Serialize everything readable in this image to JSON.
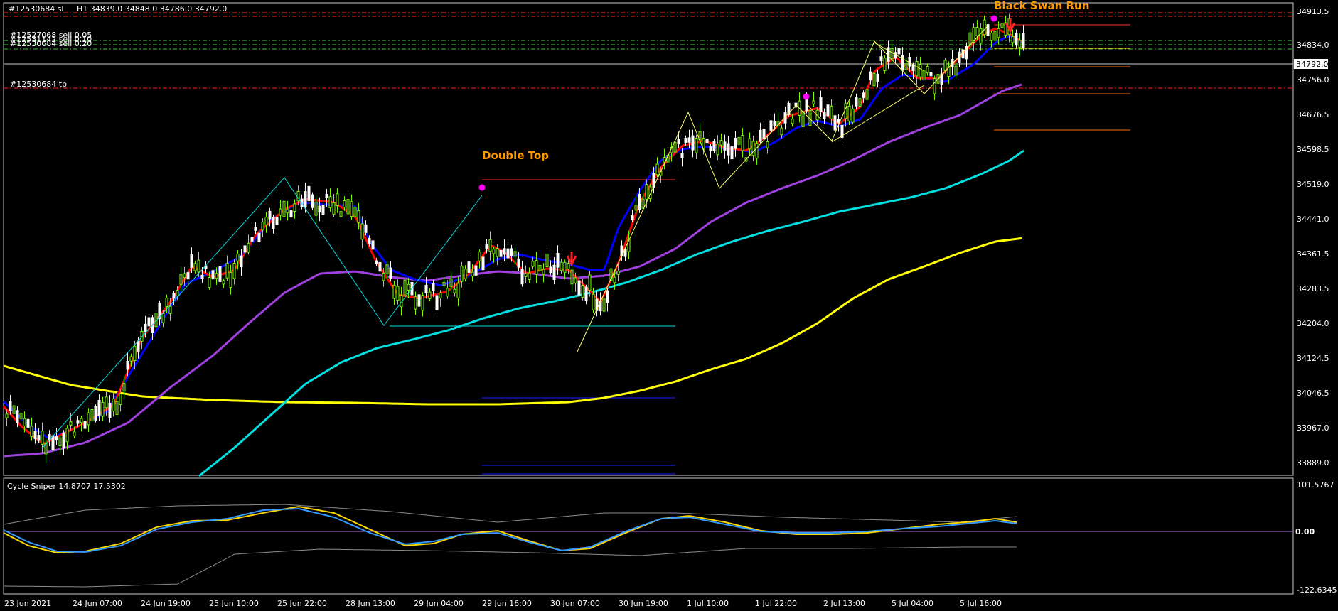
{
  "colors": {
    "background": "#000000",
    "frame": "#c8c8c8",
    "bull_candle": "#7cfc00",
    "bear_candle": "#ffffff",
    "ma_fast": "#ff0000",
    "ma_mid": "#0000ff",
    "ma_slow": "#a040e0",
    "ma_slower": "#00e0e0",
    "ma_slowest": "#ffff00",
    "order_line": "#ff2020",
    "order_line_green": "#30d030",
    "pattern_label": "#ff9900",
    "signal_dot": "#ff00ff",
    "osc_yellow": "#ffd700",
    "osc_blue": "#3399ff",
    "osc_zero": "#b070e0",
    "osc_band": "#8c8c8c"
  },
  "header": {
    "symbol_text": "#12530684 sl",
    "ohlc_text": "H1  34839.0 34848.0 34786.0 34792.0"
  },
  "orders": [
    {
      "label": "#12527068 sell 0.05"
    },
    {
      "label": "#12531142 sell 0.10"
    },
    {
      "label": "#12530684 sell 0.20"
    },
    {
      "label": "#12530684 tp"
    }
  ],
  "patterns": {
    "double_top": "Double Top",
    "black_swan": "Black Swan Run"
  },
  "price_axis": {
    "ticks": [
      "34913.5",
      "34834.0",
      "34756.0",
      "34676.5",
      "34598.5",
      "34519.0",
      "34441.0",
      "34361.5",
      "34283.5",
      "34204.0",
      "34124.5",
      "34046.5",
      "33967.0",
      "33889.0"
    ],
    "current_price": "34792.0"
  },
  "time_axis": {
    "labels": [
      "23 Jun 2021",
      "24 Jun 07:00",
      "24 Jun 19:00",
      "25 Jun 10:00",
      "25 Jun 22:00",
      "28 Jun 13:00",
      "29 Jun 04:00",
      "29 Jun 16:00",
      "30 Jun 07:00",
      "30 Jun 19:00",
      "1 Jul 10:00",
      "1 Jul 22:00",
      "2 Jul 13:00",
      "5 Jul 04:00",
      "5 Jul 16:00"
    ]
  },
  "oscillator": {
    "title": "Cycle Sniper 14.8707 17.5302",
    "ticks": [
      "101.5767",
      "0.00",
      "-122.6345"
    ]
  }
}
